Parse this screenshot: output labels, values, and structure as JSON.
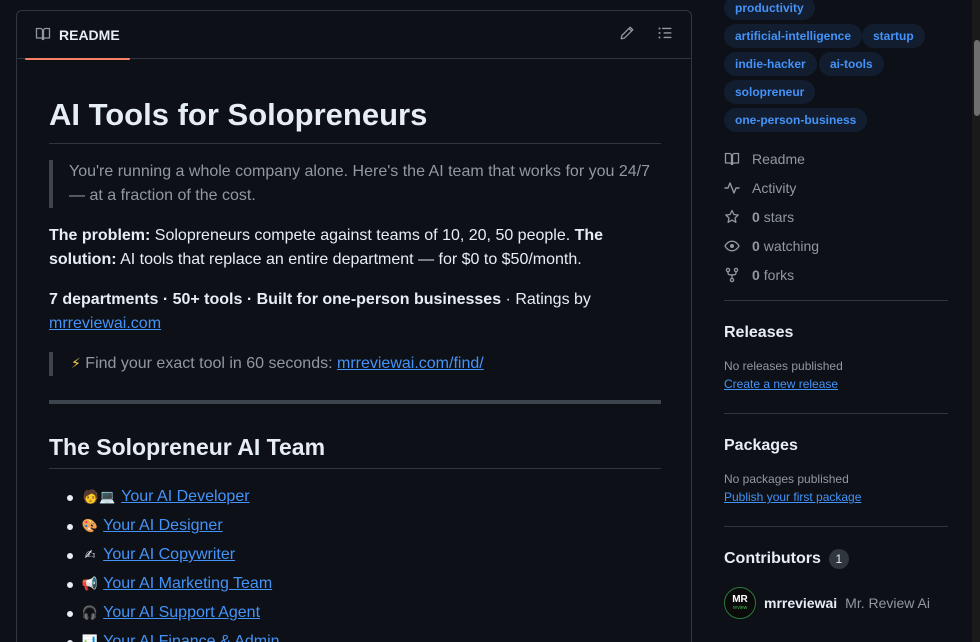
{
  "readme": {
    "tab_label": "README",
    "title": "AI Tools for Solopreneurs",
    "intro_quote": "You're running a whole company alone. Here's the AI team that works for you 24/7 — at a fraction of the cost.",
    "problem_label": "The problem:",
    "problem_text": " Solopreneurs compete against teams of 10, 20, 50 people. ",
    "solution_label": "The solution:",
    "solution_text": " AI tools that replace an entire department — for $0 to $50/month.",
    "stats_bold": "7 departments · 50+ tools · Built for one-person businesses",
    "stats_tail": " · Ratings by ",
    "ratings_link": "mrreviewai.com",
    "find_emoji": "⚡",
    "find_text": " Find your exact tool in 60 seconds: ",
    "find_link": "mrreviewai.com/find/",
    "section_title": "The Solopreneur AI Team",
    "team": [
      {
        "emoji": "🧑💻",
        "label": "Your AI Developer"
      },
      {
        "emoji": "🎨",
        "label": "Your AI Designer"
      },
      {
        "emoji": "✍",
        "label": "Your AI Copywriter"
      },
      {
        "emoji": "📢",
        "label": "Your AI Marketing Team"
      },
      {
        "emoji": "🎧",
        "label": "Your AI Support Agent"
      },
      {
        "emoji": "📊",
        "label": "Your AI Finance & Admin"
      }
    ]
  },
  "sidebar": {
    "topics": [
      "productivity",
      "artificial-intelligence",
      "startup",
      "indie-hacker",
      "ai-tools",
      "solopreneur",
      "one-person-business"
    ],
    "meta": {
      "readme": "Readme",
      "activity": "Activity",
      "stars_count": "0",
      "stars_label": "stars",
      "watching_count": "0",
      "watching_label": "watching",
      "forks_count": "0",
      "forks_label": "forks"
    },
    "releases": {
      "heading": "Releases",
      "empty": "No releases published",
      "link": "Create a new release"
    },
    "packages": {
      "heading": "Packages",
      "empty": "No packages published",
      "link": "Publish your first package"
    },
    "contributors": {
      "heading": "Contributors",
      "count": "1",
      "avatar_initials": "MR",
      "avatar_sub": "review",
      "login": "mrreviewai",
      "name": "Mr. Review Ai"
    }
  },
  "colors": {
    "background": "#0d1117",
    "link": "#4493f8",
    "border": "#30363d",
    "tab_accent": "#f78166"
  }
}
